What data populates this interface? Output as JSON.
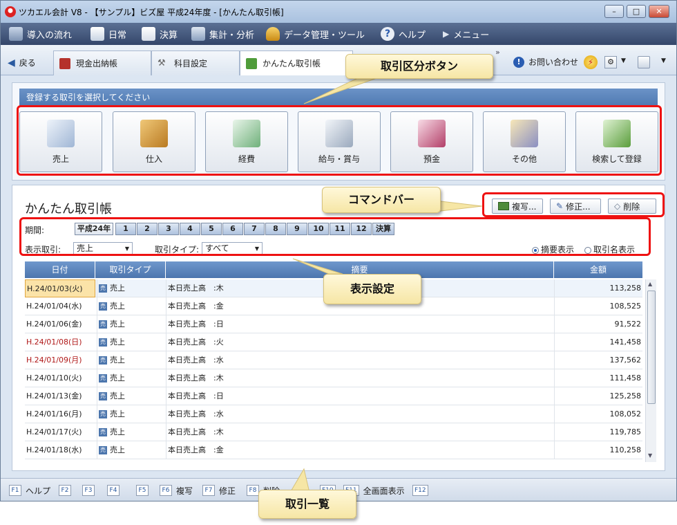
{
  "window": {
    "title": "ツカエル会計 V8 - 【サンプル】ビズ屋 平成24年度 - [かんたん取引帳]",
    "controls": [
      "–",
      "□",
      "✕"
    ]
  },
  "menu": {
    "items": [
      "導入の流れ",
      "日常",
      "決算",
      "集計・分析",
      "データ管理・ツール",
      "ヘルプ",
      "メニュー"
    ]
  },
  "tabs": {
    "back_label": "戻る",
    "items": [
      "現金出納帳",
      "科目設定",
      "かんたん取引帳"
    ],
    "overflow": "»",
    "contact_label": "お問い合わせ"
  },
  "selector": {
    "header": "登録する取引を選択してください",
    "buttons": [
      "売上",
      "仕入",
      "経費",
      "給与・賞与",
      "預金",
      "その他",
      "検索して登録"
    ]
  },
  "ledger": {
    "title": "かんたん取引帳",
    "commands": {
      "copy": "複写...",
      "edit": "修正...",
      "delete": "削除"
    },
    "period_label": "期間:",
    "periods": [
      "平成24年",
      "1",
      "2",
      "3",
      "4",
      "5",
      "6",
      "7",
      "8",
      "9",
      "10",
      "11",
      "12",
      "決算"
    ],
    "display_label": "表示取引:",
    "display_value": "売上",
    "type_label": "取引タイプ:",
    "type_value": "すべて",
    "radio_summary": "摘要表示",
    "radio_name": "取引名表示",
    "columns": [
      "日付",
      "取引タイプ",
      "摘要",
      "金額"
    ],
    "badge": "売",
    "rows": [
      {
        "date": "H.24/01/03(火)",
        "type": "売上",
        "desc": "本日売上高　:木",
        "amount": "113,258"
      },
      {
        "date": "H.24/01/04(水)",
        "type": "売上",
        "desc": "本日売上高　:金",
        "amount": "108,525"
      },
      {
        "date": "H.24/01/06(金)",
        "type": "売上",
        "desc": "本日売上高　:日",
        "amount": "91,522"
      },
      {
        "date": "H.24/01/08(日)",
        "type": "売上",
        "desc": "本日売上高　:火",
        "amount": "141,458"
      },
      {
        "date": "H.24/01/09(月)",
        "type": "売上",
        "desc": "本日売上高　:水",
        "amount": "137,562"
      },
      {
        "date": "H.24/01/10(火)",
        "type": "売上",
        "desc": "本日売上高　:木",
        "amount": "111,458"
      },
      {
        "date": "H.24/01/13(金)",
        "type": "売上",
        "desc": "本日売上高　:日",
        "amount": "125,258"
      },
      {
        "date": "H.24/01/16(月)",
        "type": "売上",
        "desc": "本日売上高　:水",
        "amount": "108,052"
      },
      {
        "date": "H.24/01/17(火)",
        "type": "売上",
        "desc": "本日売上高　:木",
        "amount": "119,785"
      },
      {
        "date": "H.24/01/18(水)",
        "type": "売上",
        "desc": "本日売上高　:金",
        "amount": "110,258"
      }
    ],
    "holiday_color": "#b01818"
  },
  "funckeys": {
    "keys": [
      {
        "key": "F1",
        "label": "ヘルプ"
      },
      {
        "key": "F2",
        "label": ""
      },
      {
        "key": "F3",
        "label": ""
      },
      {
        "key": "F4",
        "label": ""
      },
      {
        "key": "F5",
        "label": ""
      },
      {
        "key": "F6",
        "label": "複写"
      },
      {
        "key": "F7",
        "label": "修正"
      },
      {
        "key": "F8",
        "label": "削除"
      },
      {
        "key": "F10",
        "label": ""
      },
      {
        "key": "F11",
        "label": "全画面表示"
      },
      {
        "key": "F12",
        "label": ""
      }
    ]
  },
  "callouts": {
    "category_buttons": "取引区分ボタン",
    "command_bar": "コマンドバー",
    "display_settings": "表示設定",
    "list": "取引一覧"
  },
  "colors": {
    "accent": "#4e78b1",
    "highlight": "#e11111",
    "callout": "#f6e6a5"
  }
}
